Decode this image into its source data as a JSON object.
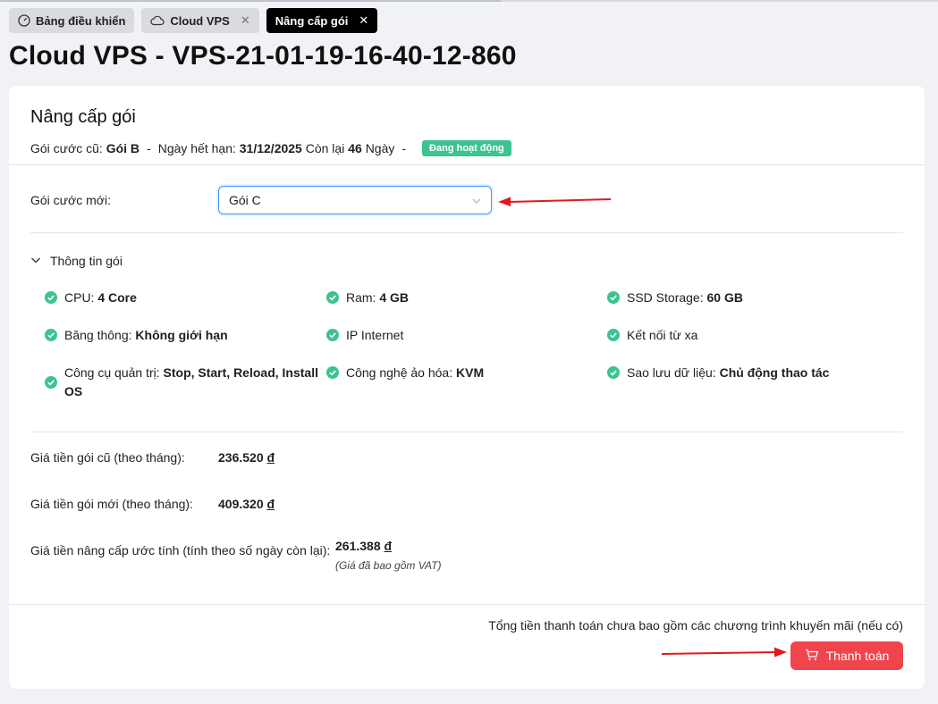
{
  "tabs": [
    {
      "label": "Bảng điều khiển",
      "icon": "dashboard-icon",
      "closable": false
    },
    {
      "label": "Cloud VPS",
      "icon": "cloud-icon",
      "closable": true
    },
    {
      "label": "Nâng cấp gói",
      "closable": true,
      "active": true
    }
  ],
  "tab_close_glyph": "✕",
  "page_title": "Cloud VPS - VPS-21-01-19-16-40-12-860",
  "card": {
    "title": "Nâng cấp gói",
    "old_plan_label": "Gói cước cũ:",
    "old_plan": "Gói B",
    "dash": "-",
    "expiry_label": "Ngày hết hạn:",
    "expiry": "31/12/2025",
    "remaining_label": "Còn lại",
    "remaining_days": "46",
    "days_unit": "Ngày",
    "status": "Đang hoạt động"
  },
  "new_plan": {
    "label": "Gói cước mới:",
    "selected": "Gói C"
  },
  "plan_info": {
    "title": "Thông tin gói",
    "features": [
      {
        "label": "CPU:",
        "value": "4 Core"
      },
      {
        "label": "Ram:",
        "value": "4 GB"
      },
      {
        "label": "SSD Storage:",
        "value": "60 GB"
      },
      {
        "label": "Băng thông:",
        "value": "Không giới hạn"
      },
      {
        "label": "IP Internet",
        "value": ""
      },
      {
        "label": "Kết nối từ xa",
        "value": ""
      },
      {
        "label": "Công cụ quản trị:",
        "value": "Stop, Start, Reload, Install OS"
      },
      {
        "label": "Công nghệ ảo hóa:",
        "value": "KVM"
      },
      {
        "label": "Sao lưu dữ liệu:",
        "value": "Chủ động thao tác"
      }
    ]
  },
  "prices": {
    "old_label": "Giá tiền gói cũ (theo tháng):",
    "old_value": "236.520",
    "new_label": "Giá tiền gói mới (theo tháng):",
    "new_value": "409.320",
    "upgrade_label": "Giá tiền nâng cấp ước tính (tính theo số ngày còn lại):",
    "upgrade_value": "261.388",
    "currency": "đ",
    "vat_note": "(Giá đã bao gồm VAT)"
  },
  "footer": {
    "note": "Tổng tiền thanh toán chưa bao gồm các chương trình khuyến mãi (nếu có)",
    "pay_label": "Thanh toán"
  },
  "colors": {
    "accent": "#f0454d",
    "badge": "#3cc48e",
    "check": "#3cc48e",
    "focus": "#4096ff",
    "arrow": "#e0191f"
  }
}
